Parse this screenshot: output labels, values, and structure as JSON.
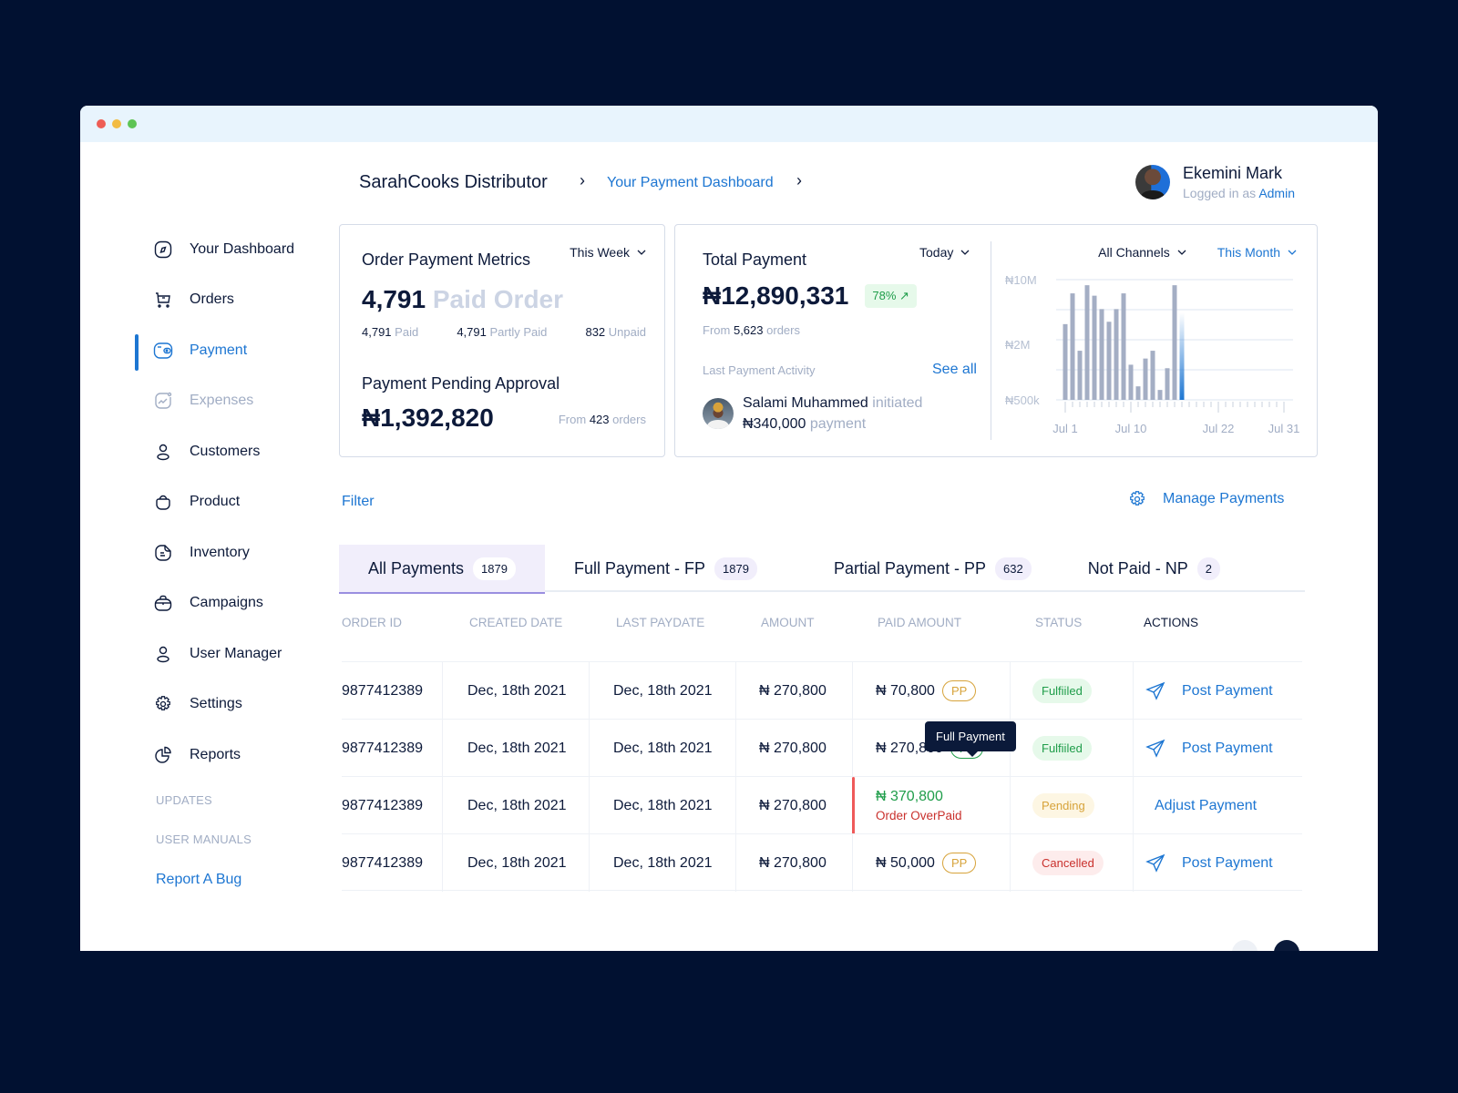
{
  "window": {
    "controls": [
      "close",
      "minimize",
      "maximize"
    ]
  },
  "header": {
    "brand": "SarahCooks Distributor",
    "breadcrumb_current": "Your Payment Dashboard",
    "user": {
      "name": "Ekemini Mark",
      "logged_in_prefix": "Logged in as",
      "role": "Admin"
    }
  },
  "sidebar": {
    "items": [
      {
        "label": "Your Dashboard",
        "icon": "compass-icon",
        "state": "normal"
      },
      {
        "label": "Orders",
        "icon": "cart-icon",
        "state": "normal"
      },
      {
        "label": "Payment",
        "icon": "wallet-icon",
        "state": "active"
      },
      {
        "label": "Expenses",
        "icon": "chart-line-icon",
        "state": "muted"
      },
      {
        "label": "Customers",
        "icon": "user-icon",
        "state": "normal"
      },
      {
        "label": "Product",
        "icon": "bag-icon",
        "state": "normal"
      },
      {
        "label": "Inventory",
        "icon": "document-icon",
        "state": "normal"
      },
      {
        "label": "Campaigns",
        "icon": "briefcase-icon",
        "state": "normal"
      },
      {
        "label": "User Manager",
        "icon": "user-icon",
        "state": "normal"
      },
      {
        "label": "Settings",
        "icon": "gear-icon",
        "state": "normal"
      },
      {
        "label": "Reports",
        "icon": "pie-chart-icon",
        "state": "normal"
      }
    ],
    "sections": [
      "UPDATES",
      "USER MANUALS"
    ],
    "report_bug": "Report A Bug"
  },
  "metrics_card": {
    "title": "Order Payment Metrics",
    "period": "This Week",
    "paid_orders_value": "4,791",
    "paid_orders_label": "Paid Order",
    "breakdown": [
      {
        "value": "4,791",
        "label": "Paid"
      },
      {
        "value": "4,791",
        "label": "Partly Paid"
      },
      {
        "value": "832",
        "label": "Unpaid"
      }
    ],
    "pending_title": "Payment Pending Approval",
    "pending_value": "₦1,392,820",
    "pending_from_prefix": "From",
    "pending_orders": "423",
    "pending_from_suffix": "orders"
  },
  "total_card": {
    "title": "Total Payment",
    "period": "Today",
    "value": "₦12,890,331",
    "change": "78% ↗",
    "from_prefix": "From",
    "orders": "5,623",
    "from_suffix": "orders",
    "activity_label": "Last Payment Activity",
    "see_all": "See all",
    "activity": {
      "name": "Salami Muhammed",
      "verb": "initiated",
      "amount": "₦340,000",
      "suffix": "payment"
    },
    "channel_filter": "All Channels",
    "chart_period": "This Month"
  },
  "chart_data": {
    "type": "bar",
    "title": "",
    "xlabel": "",
    "ylabel": "",
    "y_scale": "log",
    "ylim": [
      500000,
      10000000
    ],
    "yticks": [
      "₦500k",
      "₦2M",
      "₦10M"
    ],
    "xticks": [
      "Jul 1",
      "Jul 10",
      "Jul 22",
      "Jul 31"
    ],
    "x": [
      1,
      2,
      3,
      4,
      5,
      6,
      7,
      8,
      9,
      10,
      11,
      12,
      13,
      14,
      15,
      16,
      17,
      18,
      19,
      20,
      21,
      22,
      23,
      24,
      25,
      26,
      27,
      28,
      29,
      30,
      31
    ],
    "values": [
      3300000,
      7100000,
      1700000,
      8700000,
      6700000,
      4800000,
      3500000,
      4800000,
      7100000,
      1200000,
      700000,
      1400000,
      1700000,
      640000,
      1100000,
      8700000,
      4400000,
      null,
      null,
      null,
      null,
      null,
      null,
      null,
      null,
      null,
      null,
      null,
      null,
      null,
      null
    ],
    "highlight_index": 16,
    "colors": {
      "bar": "#a4aec4",
      "highlight": "#1d76d2",
      "grid": "#dde4f0"
    },
    "grid": true,
    "legend": "none"
  },
  "toolbar": {
    "filter": "Filter",
    "manage": "Manage Payments"
  },
  "tabs": [
    {
      "label": "All Payments",
      "count": "1879",
      "active": true
    },
    {
      "label": "Full Payment - FP",
      "count": "1879",
      "active": false
    },
    {
      "label": "Partial Payment - PP",
      "count": "632",
      "active": false
    },
    {
      "label": "Not Paid - NP",
      "count": "2",
      "active": false
    }
  ],
  "table": {
    "columns": [
      "ORDER ID",
      "CREATED DATE",
      "LAST PAYDATE",
      "AMOUNT",
      "PAID AMOUNT",
      "STATUS",
      "ACTIONS"
    ],
    "rows": [
      {
        "order_id": "9877412389",
        "created": "Dec, 18th 2021",
        "last_paydate": "Dec, 18th 2021",
        "amount": "₦ 270,800",
        "paid": "₦ 70,800",
        "paid_tag": "PP",
        "status": "Fulfiiled",
        "status_type": "ok",
        "action": "Post Payment",
        "action_icon": true
      },
      {
        "order_id": "9877412389",
        "created": "Dec, 18th 2021",
        "last_paydate": "Dec, 18th 2021",
        "amount": "₦ 270,800",
        "paid": "₦ 270,800",
        "paid_tag": "FP",
        "status": "Fulfiiled",
        "status_type": "ok",
        "action": "Post Payment",
        "action_icon": true
      },
      {
        "order_id": "9877412389",
        "created": "Dec, 18th 2021",
        "last_paydate": "Dec, 18th 2021",
        "amount": "₦ 270,800",
        "paid": "₦ 370,800",
        "paid_note": "Order OverPaid",
        "status": "Pending",
        "status_type": "pend",
        "action": "Adjust Payment",
        "action_icon": false
      },
      {
        "order_id": "9877412389",
        "created": "Dec, 18th 2021",
        "last_paydate": "Dec, 18th 2021",
        "amount": "₦ 270,800",
        "paid": "₦ 50,000",
        "paid_tag": "PP",
        "status": "Cancelled",
        "status_type": "canc",
        "action": "Post Payment",
        "action_icon": true
      }
    ],
    "tooltip": "Full Payment"
  }
}
